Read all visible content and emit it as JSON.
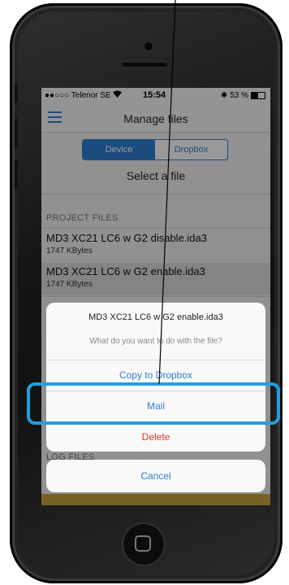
{
  "status_bar": {
    "carrier": "●●○○○ Telenor SE",
    "time": "15:54",
    "battery": "53 %",
    "battery_level": 0.53
  },
  "navbar": {
    "title": "Manage files"
  },
  "storage_tabs": {
    "selected": "Device",
    "items": [
      "Device",
      "Dropbox"
    ]
  },
  "main": {
    "select_label": "Select a file",
    "project_files_header": "PROJECT FILES",
    "files": [
      {
        "name": "MD3 XC21 LC6 w G2 disable.ida3",
        "size": "1747 KBytes"
      },
      {
        "name": "MD3 XC21 LC6 w G2 enable.ida3",
        "size": "1747 KBytes"
      }
    ],
    "log_files_header": "LOG FILES"
  },
  "action_sheet": {
    "title": "MD3 XC21 LC6 w G2 enable.ida3",
    "message": "What do you want to do with the file?",
    "copy_label": "Copy to Dropbox",
    "mail_label": "Mail",
    "delete_label": "Delete",
    "cancel_label": "Cancel"
  },
  "colors": {
    "accent": "#2f7fd0",
    "destructive": "#e0352b",
    "highlight": "#1e9fe0",
    "footer_bar": "#c9a440"
  },
  "icons": [
    "hamburger-menu-icon",
    "wifi-icon",
    "bluetooth-icon",
    "battery-icon",
    "home-button-icon"
  ]
}
